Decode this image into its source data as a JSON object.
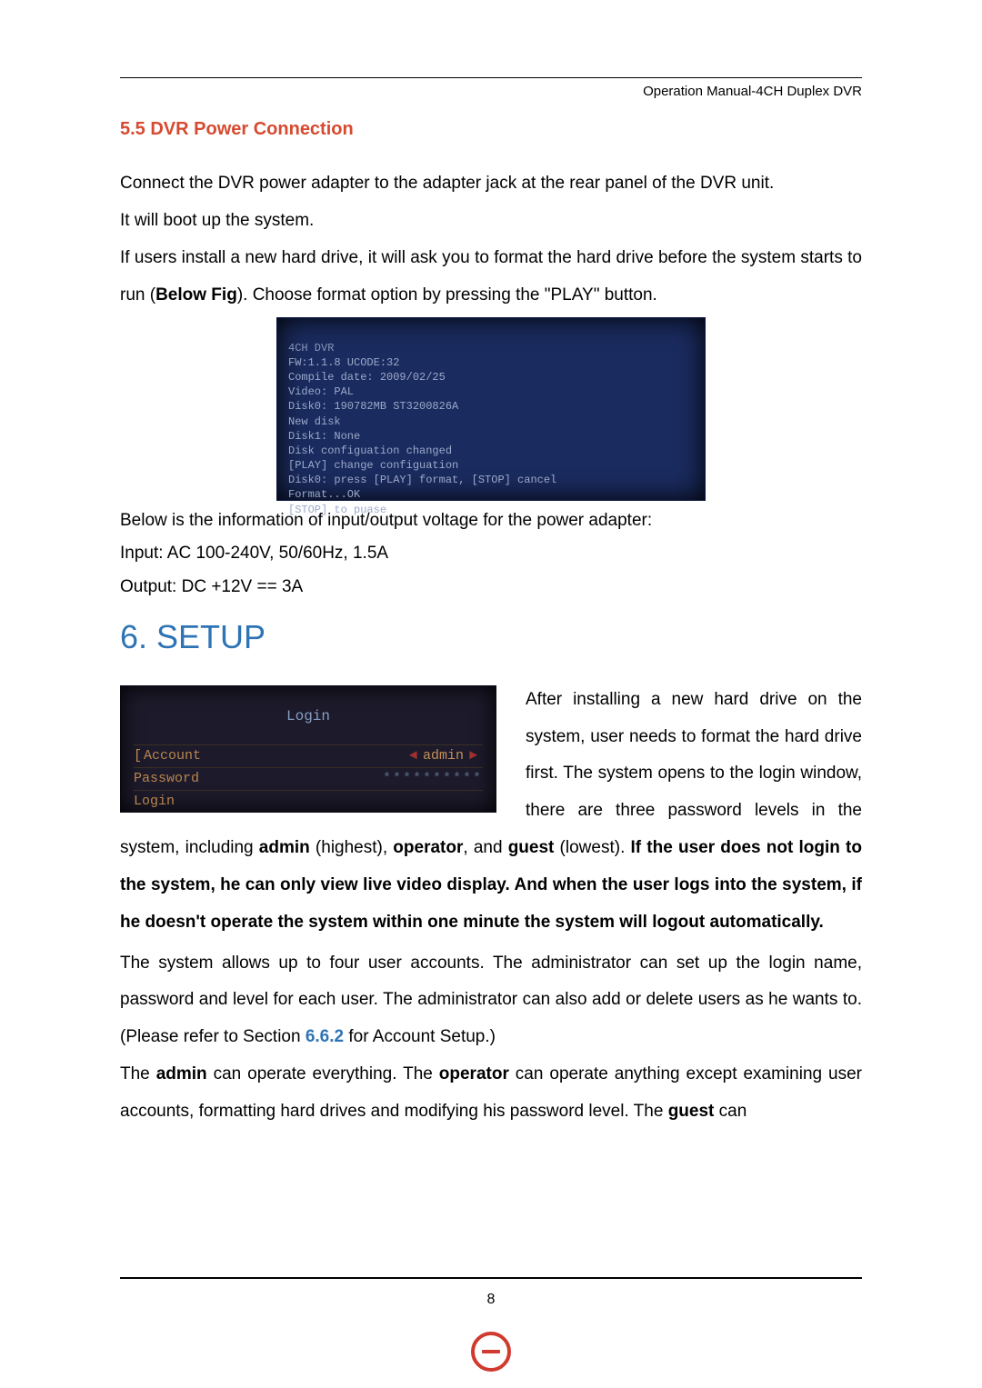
{
  "header": {
    "title": "Operation Manual-4CH Duplex DVR"
  },
  "section55": {
    "title": "5.5 DVR Power Connection",
    "p1": "Connect the DVR power adapter to the adapter jack at the rear panel of the DVR unit.",
    "p2": "It will boot up the system.",
    "p3a": "If users install a new hard drive, it will ask you to format the hard drive before the system starts to run (",
    "p3b": "Below Fig",
    "p3c": "). Choose format option by pressing the \"PLAY\" button."
  },
  "boot": {
    "l0": "4CH DVR",
    "l1": "FW:1.1.8 UCODE:32",
    "l2": "Compile date: 2009/02/25",
    "l3": "",
    "l4": "Video: PAL",
    "l5": "Disk0: 190782MB ST3200826A",
    "l6": "New disk",
    "l7": "Disk1: None",
    "l8": "Disk configuation changed",
    "l9": "[PLAY] change configuation",
    "l10": "Disk0: press [PLAY] format, [STOP] cancel",
    "l11": "Format...OK",
    "l12": "",
    "l13": "[STOP] to puase"
  },
  "after_boot": {
    "p1": "Below is the information of input/output voltage for the power adapter:",
    "p2": "Input: AC 100-240V, 50/60Hz, 1.5A",
    "p3": "Output: DC +12V == 3A"
  },
  "setup": {
    "title": "6. SETUP"
  },
  "login": {
    "title": "Login",
    "account_label": "Account",
    "account_value": "admin",
    "password_label": "Password",
    "password_value": "**********",
    "login_label": "Login"
  },
  "setup_body": {
    "wrap1a": "After installing a new hard drive on the system, user needs to format the hard drive first. The system opens to the login window, there are three password levels in the system, including ",
    "wrap1b": "admin",
    "wrap1c": " (highest), ",
    "wrap1d": "operator",
    "wrap1e": ", and ",
    "wrap1f": "guest",
    "wrap1g": " (lowest).   ",
    "wrap1h": "If the user does not login to the system, he can only view live video display. And when the user logs into the system, if he doesn't operate the system within one minute the system will logout automatically.",
    "p2a": "The system allows up to four user accounts. The administrator can set up the login name, password and level for each user. The administrator can also add or delete users as he wants to. (Please refer to Section ",
    "p2b": "6.6.2",
    "p2c": " for Account Setup.)",
    "p3a": "The ",
    "p3b": "admin",
    "p3c": " can operate everything. The ",
    "p3d": "operator",
    "p3e": " can operate anything except examining user accounts, formatting hard drives and modifying his password level. The ",
    "p3f": "guest",
    "p3g": " can"
  },
  "footer": {
    "page": "8"
  }
}
